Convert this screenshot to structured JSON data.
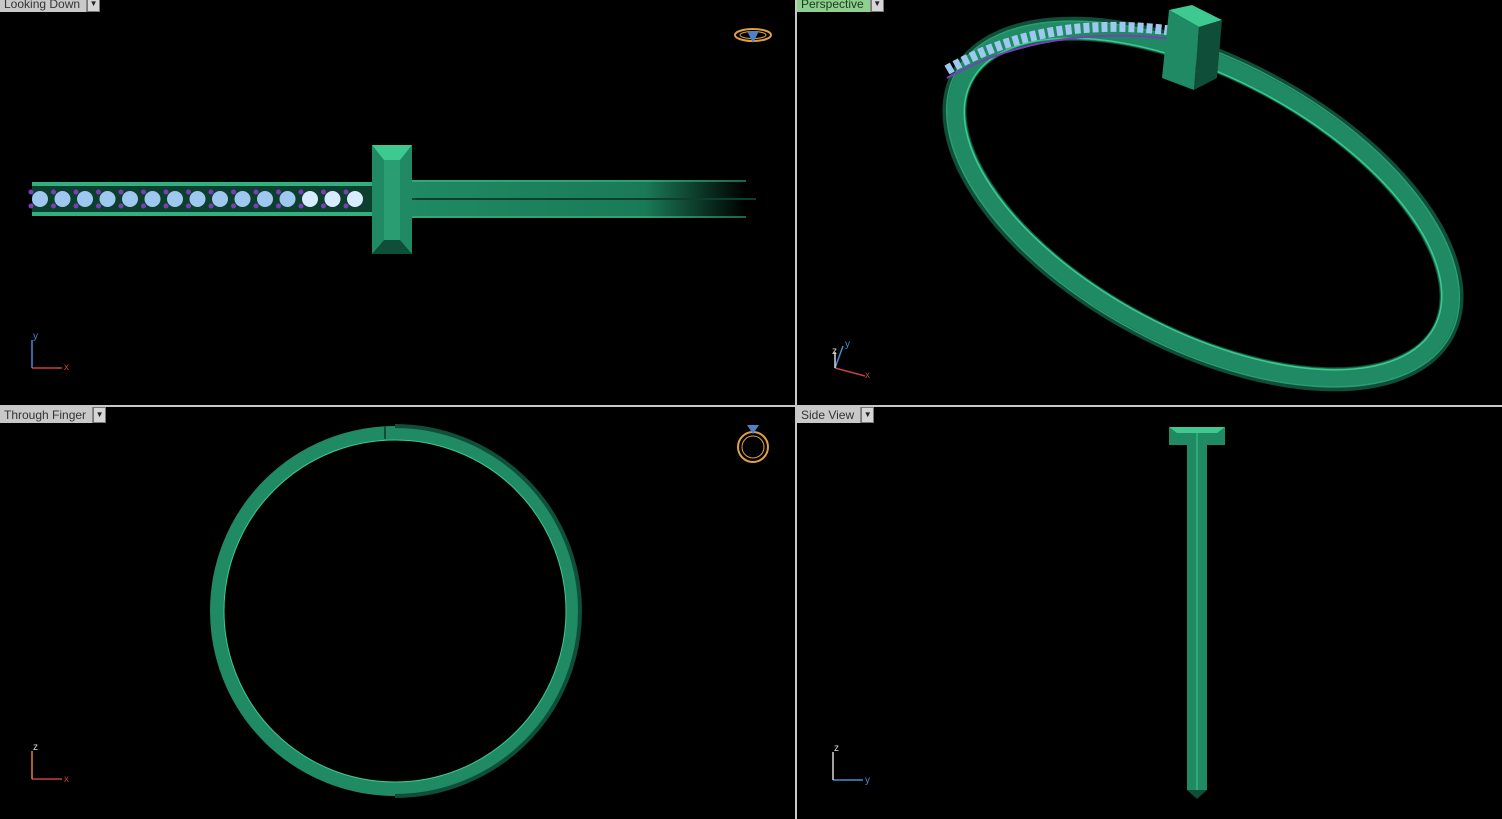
{
  "viewports": {
    "top_left": {
      "label": "Looking Down",
      "axis_up": "y",
      "axis_right": "x"
    },
    "top_right": {
      "label": "Perspective",
      "axis_up": "y",
      "axis_z": "z",
      "axis_right": "x"
    },
    "bottom_left": {
      "label": "Through Finger",
      "axis_up": "z",
      "axis_right": "x"
    },
    "bottom_right": {
      "label": "Side View",
      "axis_up": "z",
      "axis_right": "y"
    }
  },
  "icons": {
    "dropdown": "chevron-down-icon",
    "nav_top": "ring-topview-icon",
    "nav_front": "ring-front-icon"
  },
  "colors": {
    "metal": "#1f8a63",
    "metal_light": "#3dc98f",
    "metal_dark": "#0f4e38",
    "stone": "#9fc8f0",
    "prong": "#7a3fb8",
    "axis_x": "#c84040",
    "axis_y": "#3f8fd0",
    "axis_z": "#d8d8d8",
    "active_label": "#8fcf8f"
  }
}
